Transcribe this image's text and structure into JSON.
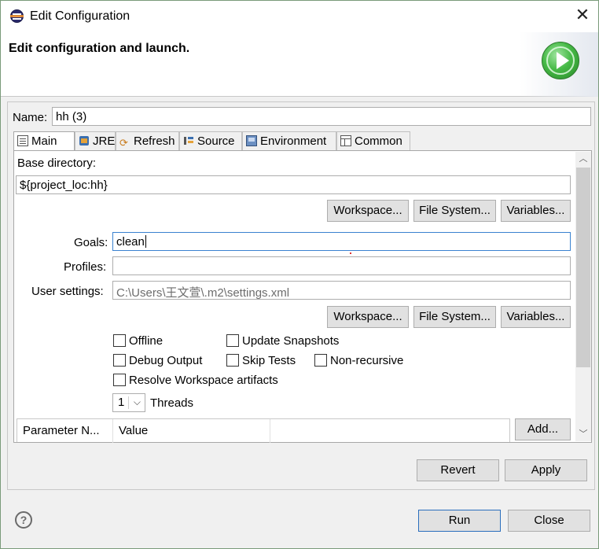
{
  "window": {
    "title": "Edit Configuration",
    "close_glyph": "✕"
  },
  "header": {
    "title": "Edit configuration and launch.",
    "icon": "run-launch-icon"
  },
  "config": {
    "name_label": "Name:",
    "name_value": "hh (3)"
  },
  "tabs": [
    {
      "label": "Main",
      "icon": "main-tab-icon"
    },
    {
      "label": "JRE",
      "icon": "jre-icon"
    },
    {
      "label": "Refresh",
      "icon": "refresh-icon"
    },
    {
      "label": "Source",
      "icon": "source-icon"
    },
    {
      "label": "Environment",
      "icon": "environment-icon"
    },
    {
      "label": "Common",
      "icon": "common-icon"
    }
  ],
  "main": {
    "base_dir_label": "Base directory:",
    "base_dir_value": "${project_loc:hh}",
    "buttons_row1": [
      "Workspace...",
      "File System...",
      "Variables..."
    ],
    "goals_label": "Goals:",
    "goals_value": "clean",
    "profiles_label": "Profiles:",
    "profiles_value": "",
    "user_settings_label": "User settings:",
    "user_settings_value": "C:\\Users\\王文萱\\.m2\\settings.xml",
    "buttons_row2": [
      "Workspace...",
      "File System...",
      "Variables..."
    ],
    "checkboxes": {
      "offline": "Offline",
      "update_snapshots": "Update Snapshots",
      "debug_output": "Debug Output",
      "skip_tests": "Skip Tests",
      "non_recursive": "Non-recursive",
      "resolve_workspace": "Resolve Workspace artifacts"
    },
    "threads_value": "1",
    "threads_label": "Threads",
    "table_headers": [
      "Parameter N...",
      "Value"
    ],
    "add_button": "Add..."
  },
  "footer": {
    "revert": "Revert",
    "apply": "Apply",
    "run": "Run",
    "close": "Close",
    "help_glyph": "?"
  }
}
